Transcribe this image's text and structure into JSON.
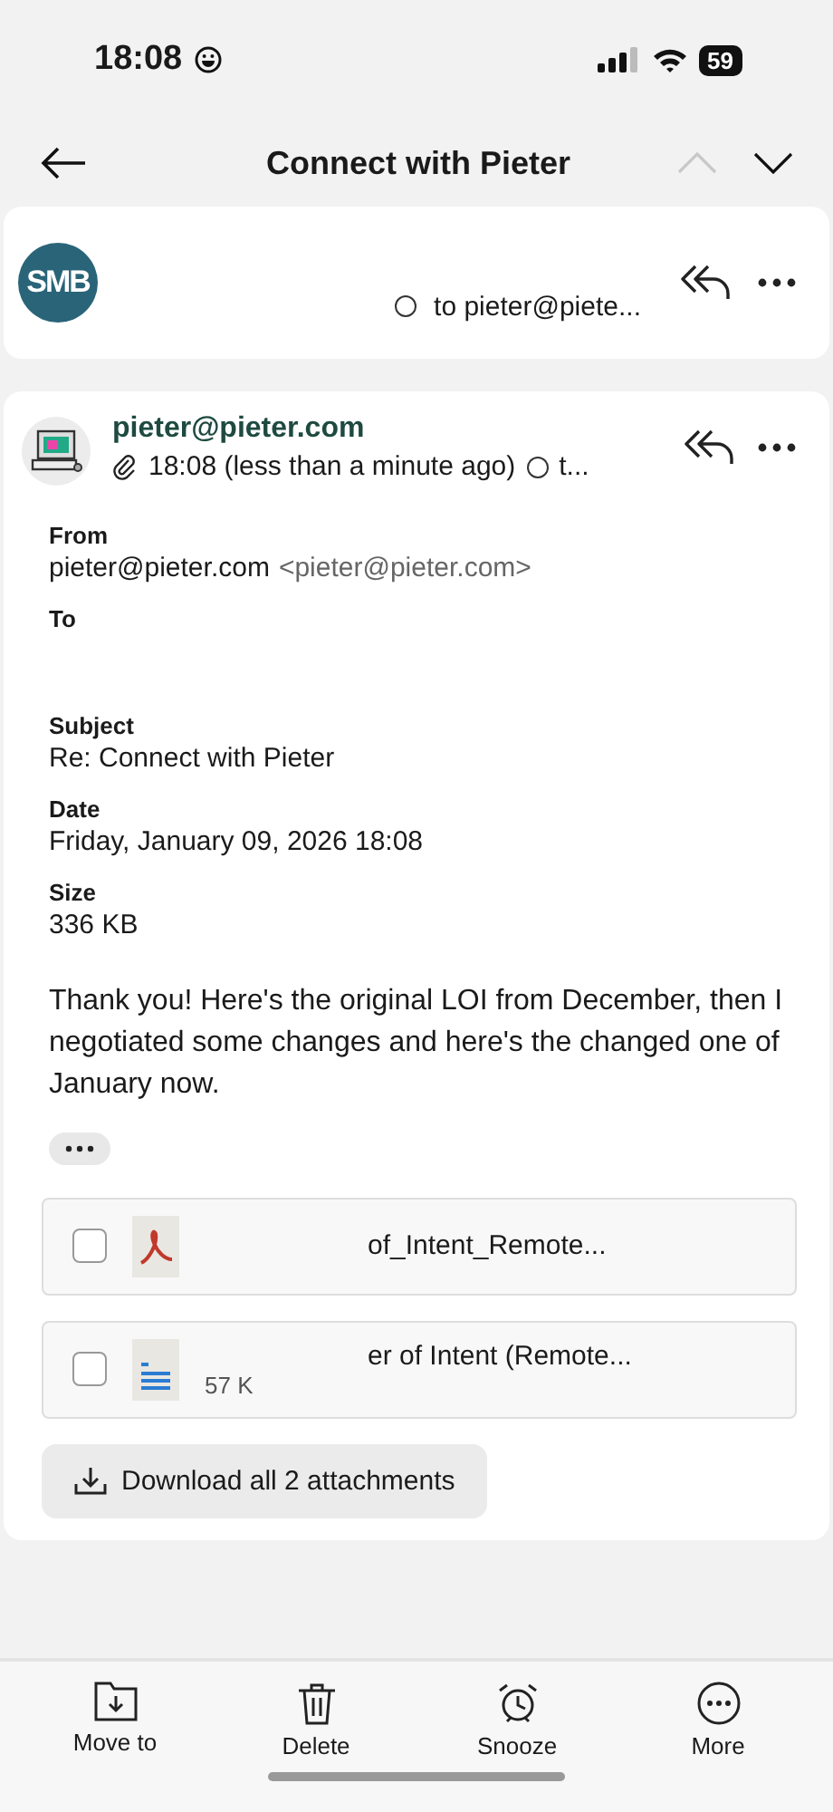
{
  "status_bar": {
    "time": "18:08",
    "battery": "59"
  },
  "header": {
    "title": "Connect with Pieter",
    "previous_disabled": true
  },
  "collapsed_message": {
    "avatar": "SMB",
    "recipient": "to pieter@piete..."
  },
  "message": {
    "sender": "pieter@pieter.com",
    "has_attachment": true,
    "time": "18:08 (less than a minute ago)",
    "recipient": "t...",
    "details": [
      {
        "label": "From",
        "value": "pieter@pieter.com",
        "note": "<pieter@pieter.com>"
      },
      {
        "label": "To"
      },
      {
        "label": "Subject",
        "value": "Re: Connect with Pieter"
      },
      {
        "label": "Date",
        "value": "Friday, January 09, 2026 18:08"
      },
      {
        "label": "Size",
        "value": "336 KB"
      }
    ],
    "body": "Thank you! Here's the original LOI from December, then I negotiated some changes and here's the changed one of January now.",
    "attachments": [
      {
        "kind": "pdf",
        "name": "of_Intent_Remote...",
        "checked": false
      },
      {
        "kind": "doc",
        "name": "er of Intent (Remote...",
        "size": "57 K",
        "checked": false
      }
    ],
    "download_button": "Download all 2 attachments"
  },
  "toolbar": [
    {
      "kind": "move",
      "label": "Move to"
    },
    {
      "kind": "delete",
      "label": "Delete"
    },
    {
      "kind": "snooze",
      "label": "Snooze"
    },
    {
      "kind": "more",
      "label": "More"
    }
  ]
}
